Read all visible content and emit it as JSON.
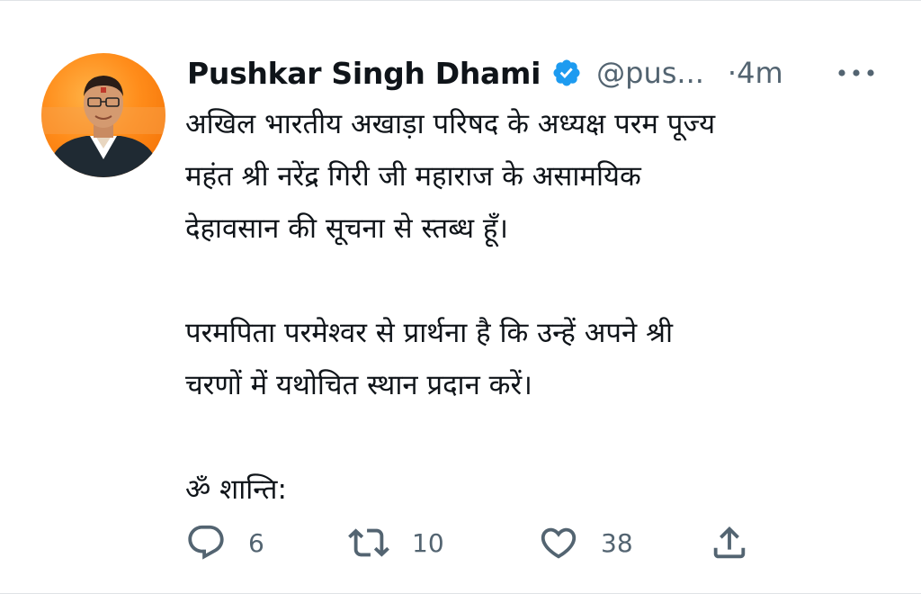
{
  "tweet": {
    "author_name": "Pushkar Singh Dhami",
    "handle": "@pus...",
    "time": "·4m",
    "paragraphs": [
      [
        "अखिल भारतीय अखाड़ा परिषद के अध्यक्ष परम पूज्य",
        "महंत श्री नरेंद्र गिरी जी महाराज के असामयिक",
        "देहावसान की सूचना से स्तब्ध हूँ।"
      ],
      [
        "परमपिता परमेश्वर से प्रार्थना है कि उन्हें अपने श्री",
        "चरणों में यथोचित स्थान प्रदान करें।"
      ],
      [
        "ॐ शान्ति:"
      ]
    ]
  },
  "actions": {
    "reply_count": "6",
    "retweet_count": "10",
    "like_count": "38"
  },
  "colors": {
    "verified_badge": "#1d9bf0",
    "secondary_text": "#536471",
    "avatar_background": "#ff8c1a"
  }
}
